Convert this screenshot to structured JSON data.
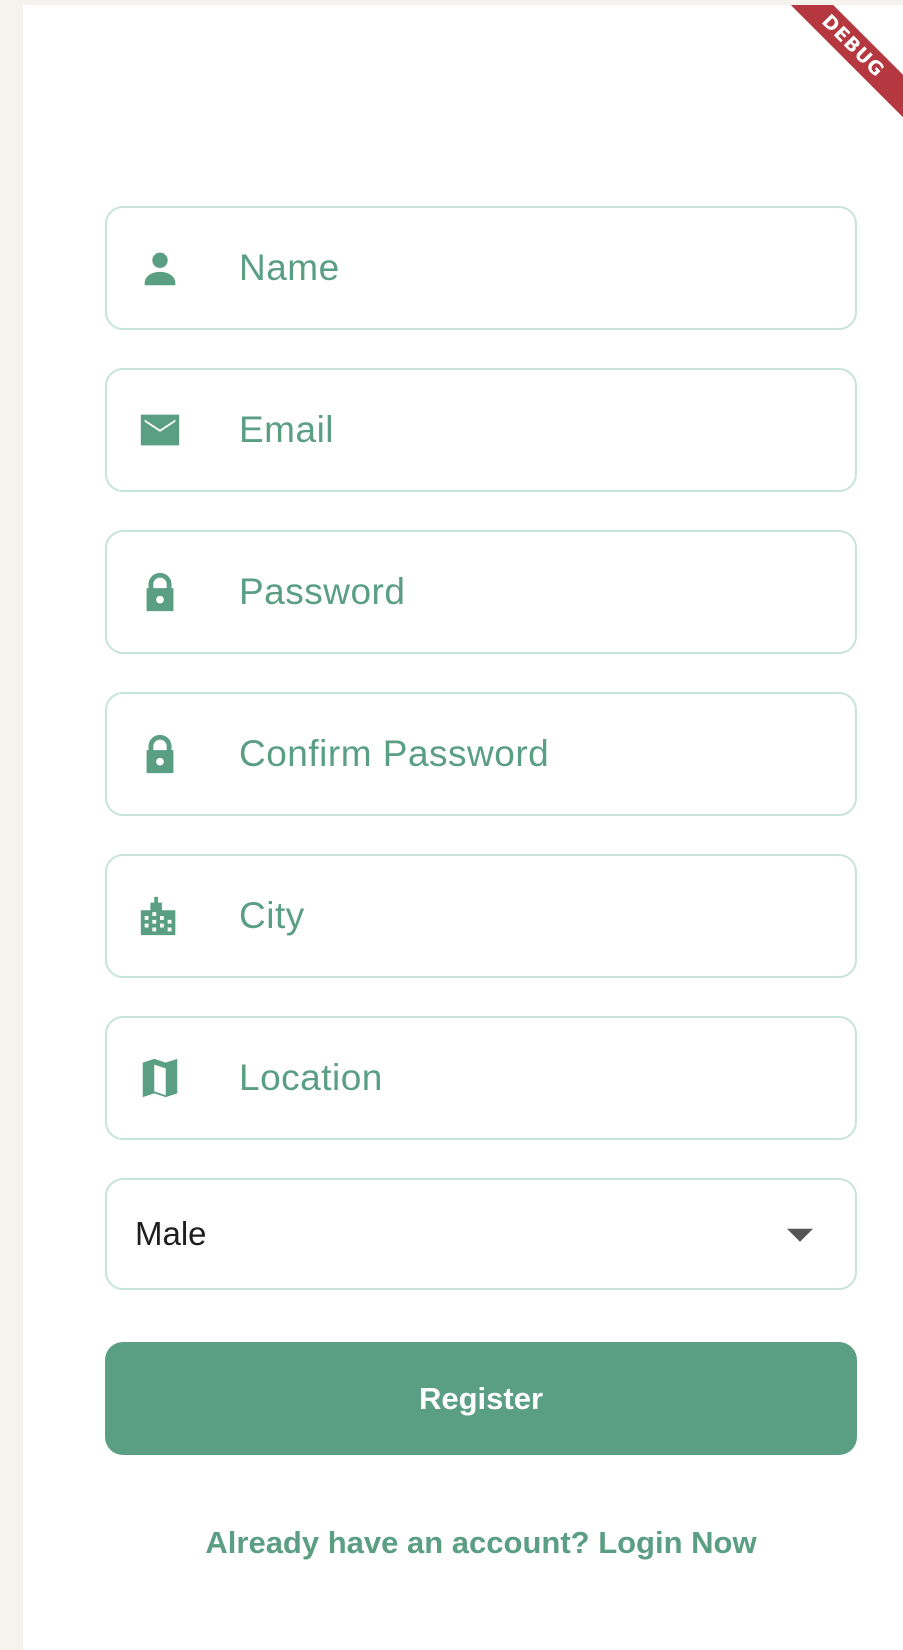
{
  "banner": {
    "label": "DEBUG"
  },
  "form": {
    "fields": [
      {
        "icon": "person-icon",
        "placeholder": "Name"
      },
      {
        "icon": "email-icon",
        "placeholder": "Email"
      },
      {
        "icon": "lock-icon",
        "placeholder": "Password"
      },
      {
        "icon": "lock-icon",
        "placeholder": "Confirm Password"
      },
      {
        "icon": "city-icon",
        "placeholder": "City"
      },
      {
        "icon": "map-icon",
        "placeholder": "Location"
      }
    ],
    "gender": {
      "selected": "Male"
    },
    "register_label": "Register",
    "login_prompt": "Already have an account? Login Now"
  },
  "colors": {
    "accent": "#5a9e83",
    "border": "#c6e4dc",
    "debug_banner": "#b5373f"
  }
}
